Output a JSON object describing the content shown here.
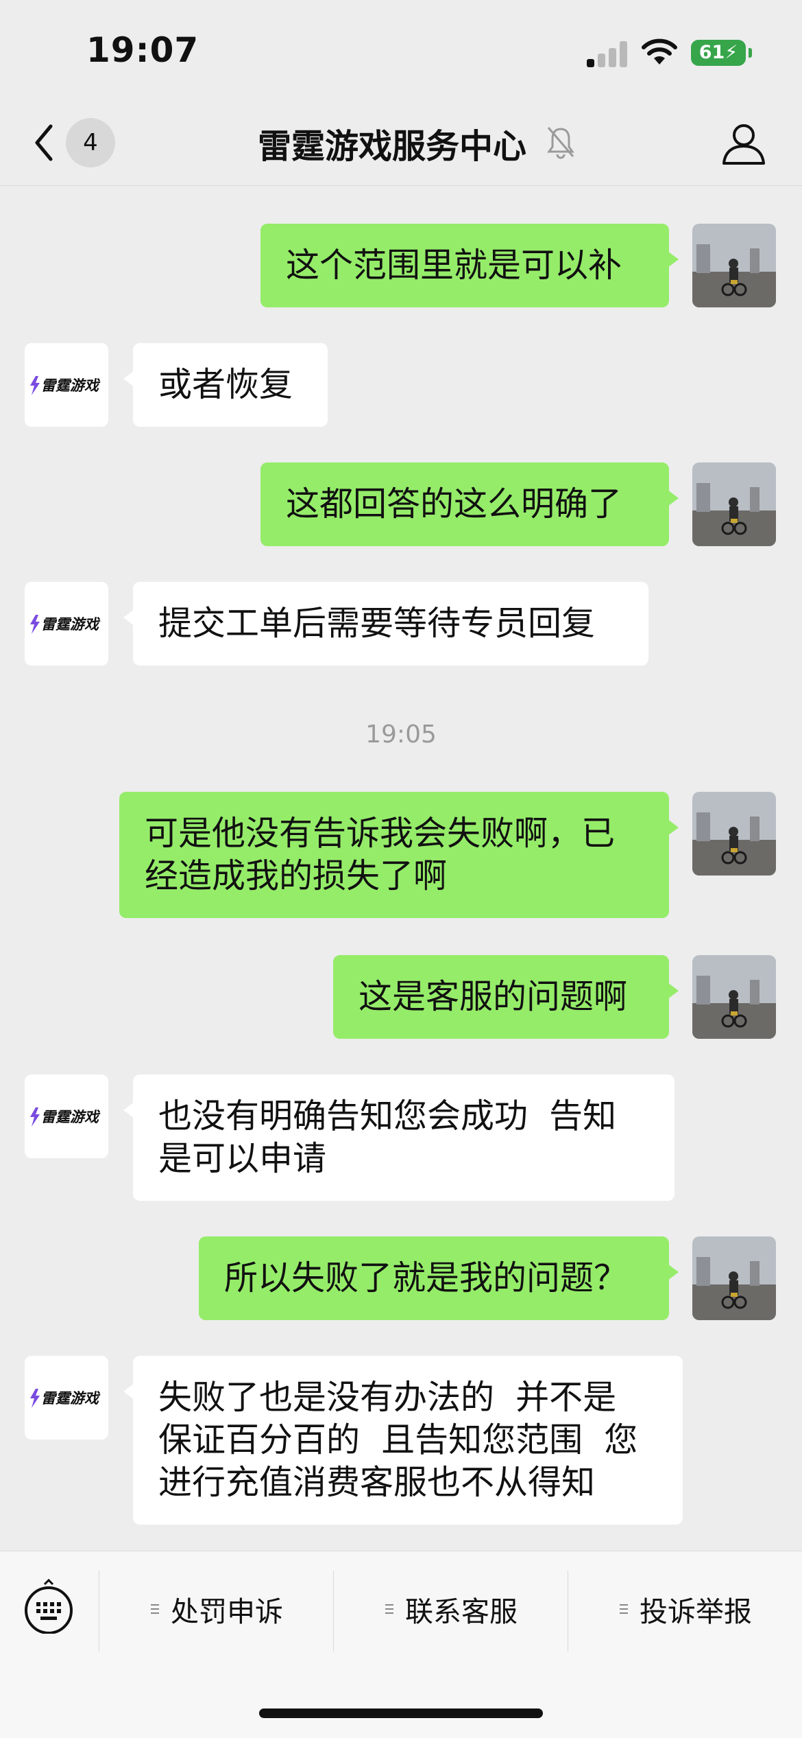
{
  "status_bar": {
    "time": "19:07",
    "battery": "61"
  },
  "header": {
    "unread_count": "4",
    "title": "雷霆游戏服务中心"
  },
  "messages": [
    {
      "from": "user",
      "text": "这个范围里就是可以补"
    },
    {
      "from": "service",
      "text": "或者恢复"
    },
    {
      "from": "user",
      "text": "这都回答的这么明确了"
    },
    {
      "from": "service",
      "text": "提交工单后需要等待专员回复"
    },
    {
      "from": "user",
      "text": "可是他没有告诉我会失败啊，已\n经造成我的损失了啊"
    },
    {
      "from": "user",
      "text": "这是客服的问题啊"
    },
    {
      "from": "service",
      "text": "也没有明确告知您会成功  告知\n是可以申请"
    },
    {
      "from": "user",
      "text": "所以失败了就是我的问题？"
    },
    {
      "from": "service",
      "text": "失败了也是没有办法的  并不是\n保证百分百的  且告知您范围  您\n进行充值消费客服也不从得知"
    }
  ],
  "timestamp": "19:05",
  "service_logo_text": "雷霆游戏",
  "bottom_menu": [
    {
      "label": "处罚申诉"
    },
    {
      "label": "联系客服"
    },
    {
      "label": "投诉举报"
    }
  ],
  "colors": {
    "sent_bubble": "#95ec69",
    "received_bubble": "#ffffff",
    "background": "#ededed",
    "battery": "#37a54a"
  },
  "icons": {
    "back": "chevron-left-icon",
    "mute": "bell-slash-icon",
    "profile": "person-icon",
    "keyboard": "keyboard-icon"
  }
}
